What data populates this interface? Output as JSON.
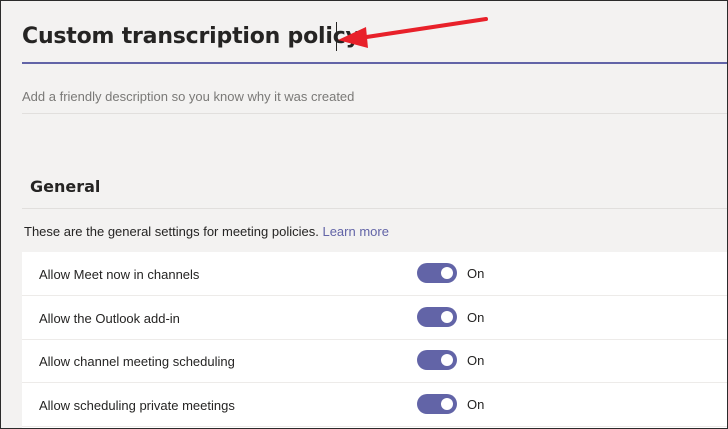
{
  "policy": {
    "name": "Custom transcription policy",
    "description_placeholder": "Add a friendly description so you know why it was created"
  },
  "general": {
    "title": "General",
    "description": "These are the general settings for meeting policies.",
    "learn_more": "Learn more",
    "settings": [
      {
        "label": "Allow Meet now in channels",
        "state": "On",
        "enabled": true
      },
      {
        "label": "Allow the Outlook add-in",
        "state": "On",
        "enabled": true
      },
      {
        "label": "Allow channel meeting scheduling",
        "state": "On",
        "enabled": true
      },
      {
        "label": "Allow scheduling private meetings",
        "state": "On",
        "enabled": true
      }
    ]
  },
  "colors": {
    "accent": "#6264a7",
    "annotation_arrow": "#e8212a",
    "background": "#f3f2f1"
  }
}
